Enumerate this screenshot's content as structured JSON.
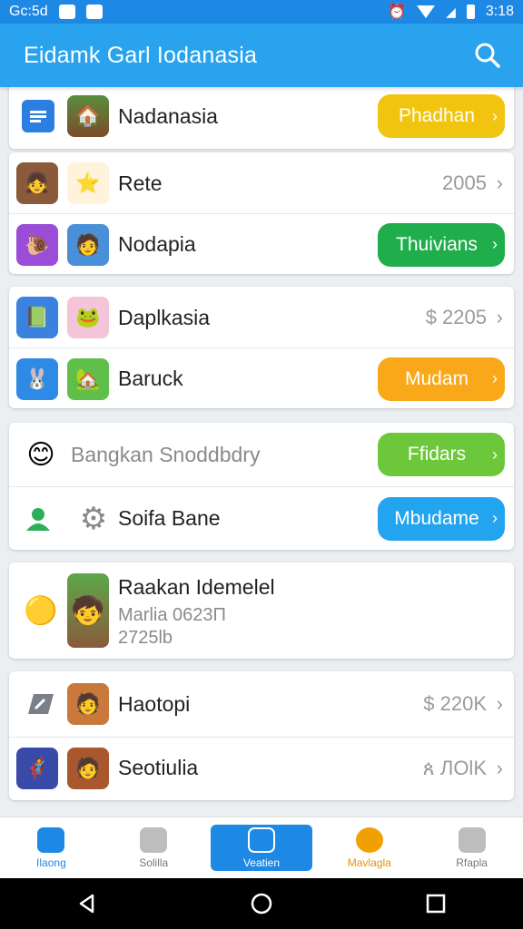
{
  "status": {
    "time_left": "Gc:5d",
    "time_right": "3:18"
  },
  "app": {
    "title": "Eidamk Garl Iodanasia"
  },
  "cards": [
    {
      "rows": [
        {
          "label": "Nadanasia",
          "button": "Phadhan",
          "btn_color": "#f1c40f"
        }
      ]
    },
    {
      "rows": [
        {
          "label": "Rete",
          "value": "2005"
        },
        {
          "label": "Nodapia",
          "button": "Thuivians",
          "btn_color": "#1fae4b"
        }
      ]
    },
    {
      "rows": [
        {
          "label": "Daplkasia",
          "value": "$ 2205"
        },
        {
          "label": "Baruck",
          "button": "Mudam",
          "btn_color": "#f9a81a"
        }
      ]
    },
    {
      "rows": [
        {
          "label": "Bangkan Snoddbdry",
          "button": "Ffidars",
          "btn_color": "#6cc83a"
        },
        {
          "label": "Soifa Bane",
          "button": "Mbudame",
          "btn_color": "#22a4ef"
        }
      ]
    },
    {
      "title": "Raakan Idemelel",
      "sub1": "Marlia 0623П",
      "sub2": "2725lb"
    },
    {
      "rows": [
        {
          "label": "Haotopi",
          "value": "$ 220K"
        },
        {
          "label": "Seotiulia",
          "value": "ጰ ЛОlK"
        }
      ]
    }
  ],
  "bottom_nav": [
    {
      "label": "Ilaong"
    },
    {
      "label": "Solilla"
    },
    {
      "label": "Veatien"
    },
    {
      "label": "Mavlagla"
    },
    {
      "label": "Rfapla"
    }
  ],
  "colors": {
    "appbar": "#29a3ee",
    "statusbar": "#1e88e5"
  }
}
